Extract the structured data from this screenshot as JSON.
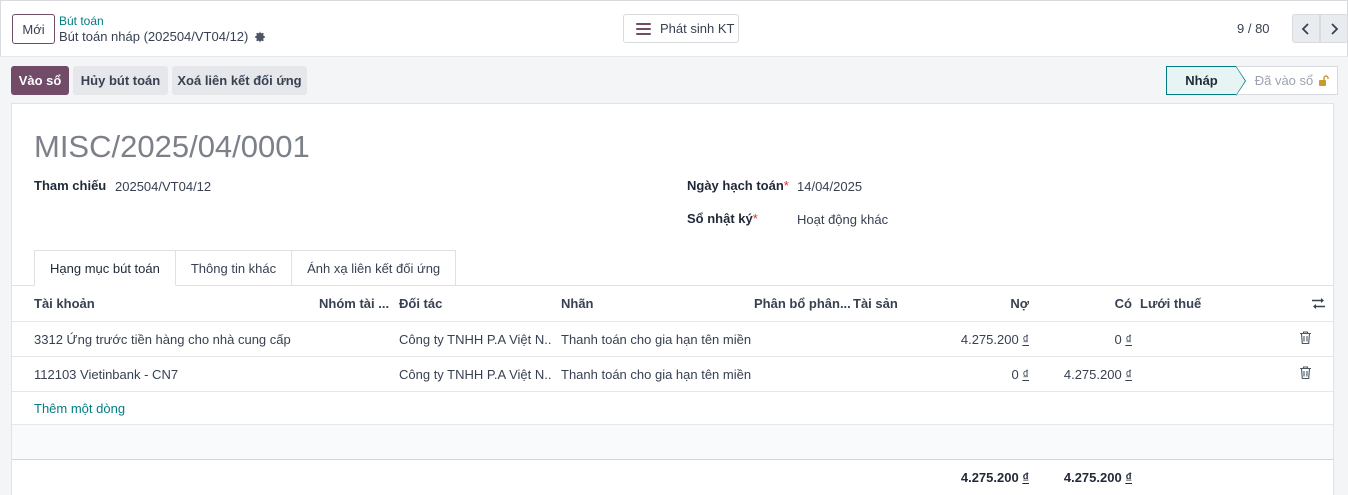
{
  "topbar": {
    "new_label": "Mới",
    "breadcrumb_parent": "Bút toán",
    "breadcrumb_current": "Bút toán nháp (202504/VT04/12)",
    "center_button": "Phát sinh KT",
    "pager": "9 / 80"
  },
  "actions": {
    "post": "Vào sổ",
    "cancel": "Hủy bút toán",
    "unlink": "Xoá liên kết đối ứng"
  },
  "status": {
    "draft": "Nháp",
    "posted": "Đã vào sổ"
  },
  "form": {
    "title": "MISC/2025/04/0001",
    "ref_label": "Tham chiếu",
    "ref_value": "202504/VT04/12",
    "date_label": "Ngày hạch toán",
    "date_value": "14/04/2025",
    "journal_label": "Sổ nhật ký",
    "journal_value": "Hoạt động khác",
    "required_mark": "*"
  },
  "tabs": [
    "Hạng mục bút toán",
    "Thông tin khác",
    "Ánh xạ liên kết đối ứng"
  ],
  "table": {
    "headers": {
      "account": "Tài khoản",
      "group": "Nhóm tài ...",
      "partner": "Đối tác",
      "label": "Nhãn",
      "analytic": "Phân bổ phân...",
      "asset": "Tài sản",
      "debit": "Nợ",
      "credit": "Có",
      "tax_grid": "Lưới thuế"
    },
    "rows": [
      {
        "account": "3312 Ứng trước tiền hàng cho nhà cung cấp",
        "partner": "Công ty TNHH P.A Việt N...",
        "label": "Thanh toán cho gia hạn tên miền",
        "debit": "4.275.200",
        "credit": "0"
      },
      {
        "account": "112103 Vietinbank - CN7",
        "partner": "Công ty TNHH P.A Việt N...",
        "label": "Thanh toán cho gia hạn tên miền",
        "debit": "0",
        "credit": "4.275.200"
      }
    ],
    "add_line": "Thêm một dòng",
    "total_debit": "4.275.200",
    "total_credit": "4.275.200",
    "currency": "₫"
  }
}
